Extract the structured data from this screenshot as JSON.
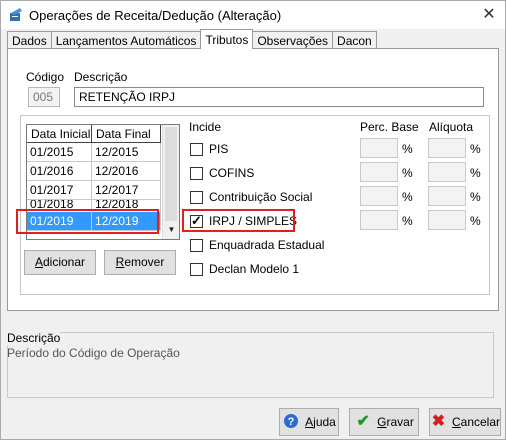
{
  "window": {
    "title": "Operações de Receita/Dedução (Alteração)",
    "close_glyph": "✕"
  },
  "tabs": [
    {
      "label": "Dados"
    },
    {
      "label": "Lançamentos Automáticos"
    },
    {
      "label": "Tributos"
    },
    {
      "label": "Observações"
    },
    {
      "label": "Dacon"
    }
  ],
  "form": {
    "codigo_label": "Código",
    "codigo_value": "005",
    "descricao_label": "Descrição",
    "descricao_value": "RETENÇÃO IRPJ"
  },
  "grid": {
    "headers": [
      "Data Inicial",
      "Data Final"
    ],
    "rows": [
      [
        "01/2015",
        "12/2015"
      ],
      [
        "01/2016",
        "12/2016"
      ],
      [
        "01/2017",
        "12/2017"
      ],
      [
        "01/2018",
        "12/2018"
      ],
      [
        "01/2019",
        "12/2019"
      ]
    ],
    "selected_row": 4
  },
  "buttons": {
    "adicionar_u": "A",
    "adicionar_rest": "dicionar",
    "remover_u": "R",
    "remover_rest": "emover"
  },
  "incide": {
    "header": "Incide",
    "perc_base_header": "Perc. Base",
    "aliquota_header": "Alíquota",
    "percent_sign": "%",
    "items": [
      {
        "label": "PIS",
        "checked": false
      },
      {
        "label": "COFINS",
        "checked": false
      },
      {
        "label": "Contribuição Social",
        "checked": false
      },
      {
        "label": "IRPJ / SIMPLES",
        "checked": true
      },
      {
        "label": "Enquadrada Estadual",
        "checked": false
      },
      {
        "label": "Declan Modelo 1",
        "checked": false
      }
    ]
  },
  "description_panel": {
    "title": "Descrição",
    "text": "Período do Código de Operação"
  },
  "footer": {
    "ajuda_u": "A",
    "ajuda_rest": "juda",
    "gravar_u": "G",
    "gravar_rest": "ravar",
    "cancelar_u": "C",
    "cancelar_rest": "ancelar"
  },
  "colors": {
    "selection": "#3399ff",
    "highlight": "#e0201f"
  }
}
